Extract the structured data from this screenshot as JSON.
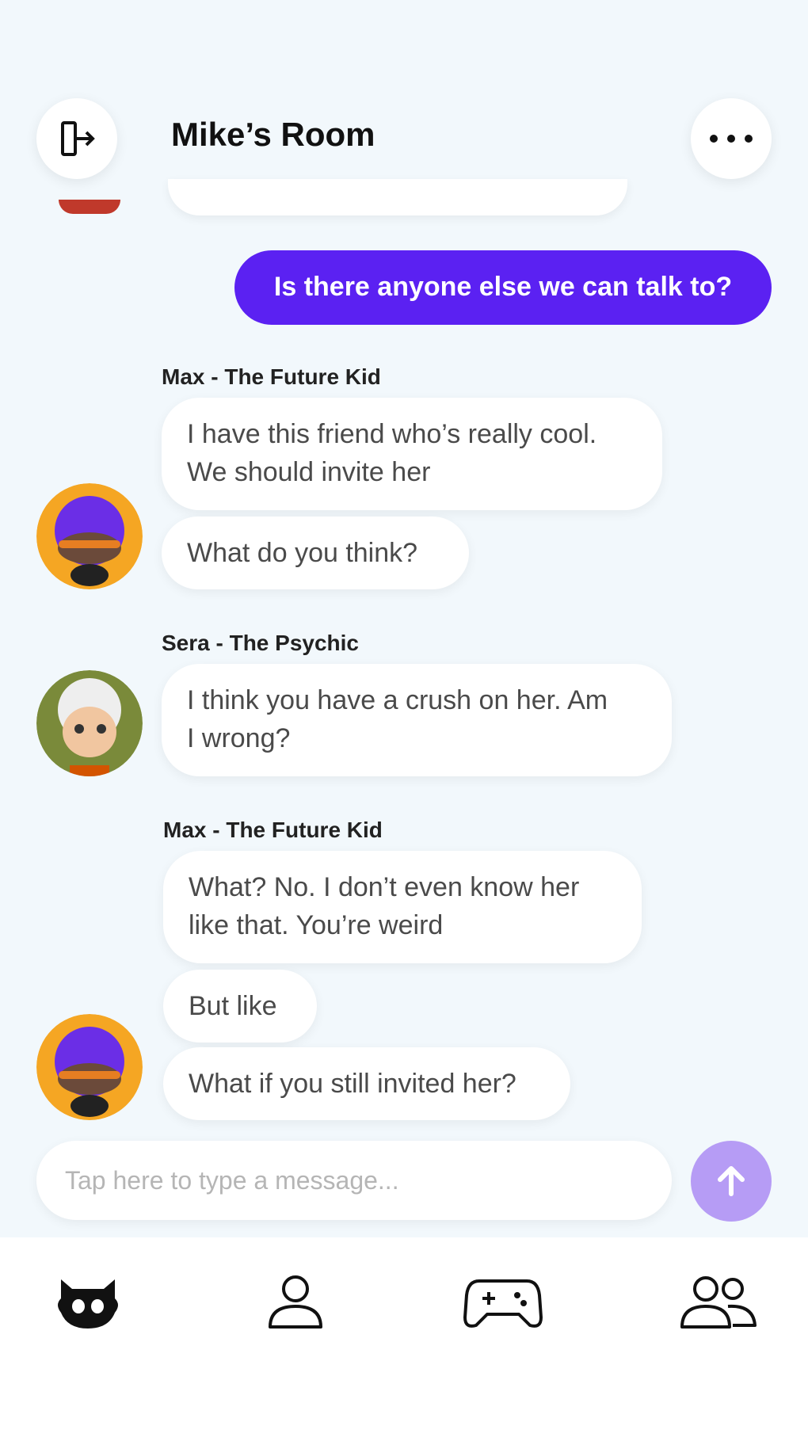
{
  "header": {
    "title": "Mike’s Room",
    "leave_icon": "leave-room-icon",
    "more_icon": "more-options-icon"
  },
  "messages": {
    "me_1": "Is there anyone else we can talk to?",
    "group_1": {
      "sender": "Max - The Future Kid",
      "lines": [
        "I have this friend who’s really cool.",
        "We should invite her",
        "What do you think?"
      ]
    },
    "group_2": {
      "sender": "Sera - The Psychic",
      "lines": [
        "I think you have a crush on her. Am",
        "I wrong?"
      ]
    },
    "group_3": {
      "sender": "Max - The Future Kid",
      "lines": [
        "What? No. I don’t even know her",
        "like that. You’re weird",
        "But like",
        "What if you still invited her?"
      ]
    }
  },
  "composer": {
    "placeholder": "Tap here to type a message..."
  },
  "nav": {
    "items": [
      "bot-icon",
      "profile-icon",
      "games-icon",
      "friends-icon"
    ]
  },
  "colors": {
    "accent": "#5b21f2",
    "send_button": "#b69cf5",
    "background": "#f2f8fc"
  }
}
